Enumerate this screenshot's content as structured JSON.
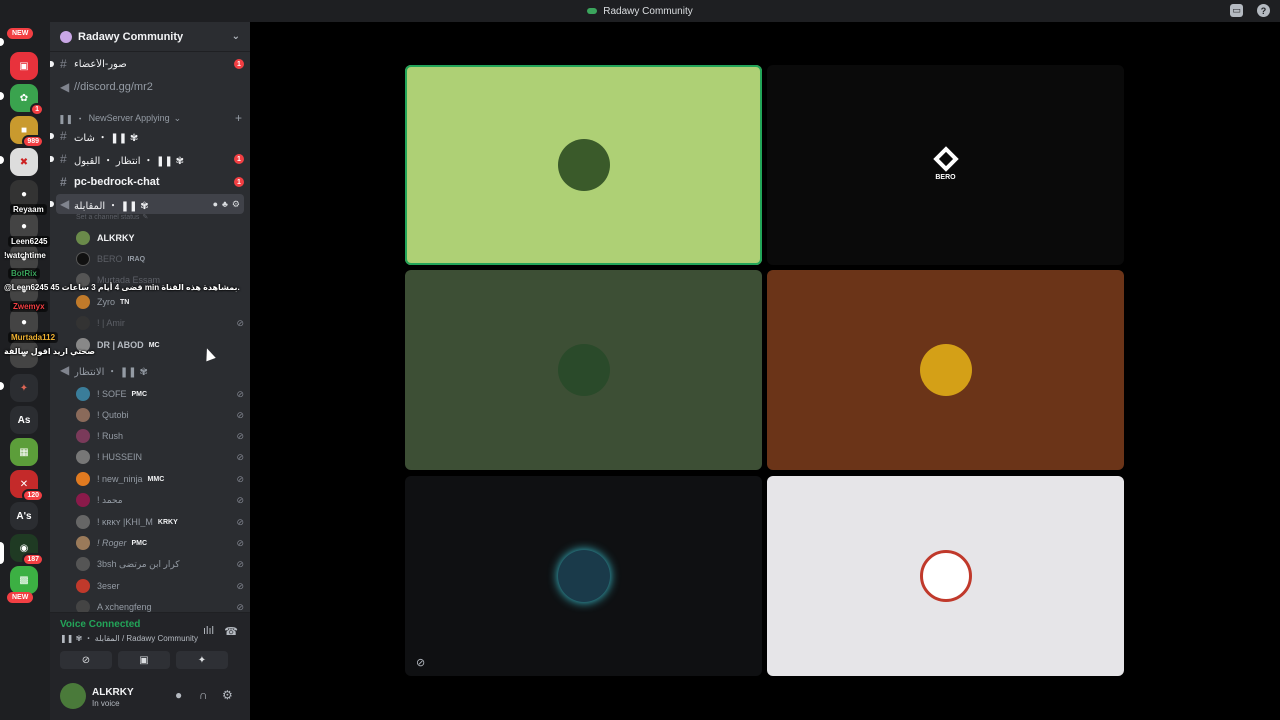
{
  "window": {
    "title": "Radawy Community"
  },
  "server": {
    "name": "Radawy Community"
  },
  "server_rail": {
    "new_label": "NEW",
    "badges": [
      "1",
      "989",
      "120",
      "187"
    ],
    "text_icons": [
      "As",
      "A's"
    ]
  },
  "channels": [
    {
      "name": "صور-الأعضاء",
      "type": "text",
      "unread": "1"
    },
    {
      "name": "//discord.gg/mr2",
      "type": "voice"
    }
  ],
  "category": {
    "name": "NewServer Applying"
  },
  "channels2": [
    {
      "name": "شات ・ ❚❚ ✾",
      "type": "text"
    },
    {
      "name": "انتظار ・ القبول ・ ❚❚ ✾",
      "type": "text",
      "unread": "1"
    },
    {
      "name": "pc-bedrock-chat",
      "type": "text",
      "unread": "1"
    },
    {
      "name": "المقابلة ・ ❚❚ ✾",
      "type": "voice"
    }
  ],
  "channel_status_placeholder": "Set a channel status",
  "interview_members": [
    {
      "name": "ALKRKY",
      "tag": ""
    },
    {
      "name": "BERO",
      "tag": "IRAQ"
    },
    {
      "name": "Murtada Essam",
      "tag": ""
    },
    {
      "name": "Zyro",
      "tag": "TN"
    },
    {
      "name": "! | Amir",
      "tag": ""
    },
    {
      "name": "DR | ABOD",
      "tag": "MC"
    }
  ],
  "waiting_channel": {
    "name": "الانتظار ・ ❚❚ ✾"
  },
  "waiting_members": [
    {
      "name": "! SOFE",
      "tag": "PMC"
    },
    {
      "name": "! Qutobi",
      "tag": ""
    },
    {
      "name": "! Rush",
      "tag": ""
    },
    {
      "name": "! HUSSEIN",
      "tag": ""
    },
    {
      "name": "! new_ninja",
      "tag": "MMC"
    },
    {
      "name": "! محمد",
      "tag": ""
    },
    {
      "name": "! ĸʀĸʏ |KHI_M",
      "tag": "KRKY"
    },
    {
      "name": "! Roger",
      "tag": "PMC"
    },
    {
      "name": "3bsh كرار ابن مرتضى",
      "tag": ""
    },
    {
      "name": "3eser",
      "tag": ""
    },
    {
      "name": "A xchengfeng",
      "tag": ""
    }
  ],
  "overlay_chat": [
    {
      "name": "Reyaam",
      "text": ""
    },
    {
      "name": "Leen6245",
      "text": "!watchtime"
    },
    {
      "name": "BotRix",
      "text": "@Leen6245 45 قضى 4 أيام 3 ساعات min بمشاهدة هذه القناة."
    },
    {
      "name": "Zwemyx",
      "text": ""
    },
    {
      "name": "Murtada112",
      "text": "صحتي اريد اقول سالفة"
    }
  ],
  "voice": {
    "status": "Voice Connected",
    "location": "❚❚ ✾ ・ المقابلة / Radawy Community"
  },
  "user": {
    "name": "ALKRKY",
    "status": "In voice"
  },
  "stage_tiles": [
    {
      "label": "",
      "color": "#aed075",
      "speaking": true
    },
    {
      "label": "BERO",
      "color": "#0a0a0a",
      "speaking": false
    },
    {
      "label": "",
      "color": "#3d4f35",
      "speaking": false
    },
    {
      "label": "",
      "color": "#6b3418",
      "speaking": false
    },
    {
      "label": "",
      "color": "#0f1012",
      "speaking": false
    },
    {
      "label": "",
      "color": "#e6e5e8",
      "speaking": false
    }
  ],
  "colors": {
    "accent": "#5865f2",
    "online": "#23a559",
    "danger": "#f23f43"
  }
}
